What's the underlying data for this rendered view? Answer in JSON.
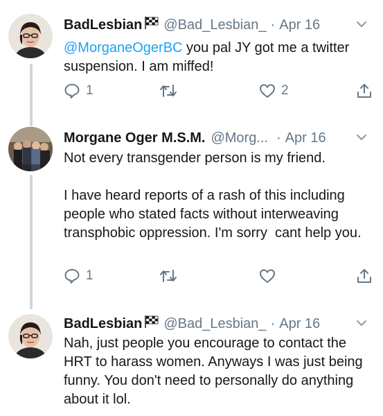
{
  "tweets": [
    {
      "display_name": "BadLesbian",
      "flag_icon": "checkered-flag-icon",
      "handle": "@Bad_Lesbian_",
      "separator": "·",
      "date": "Apr 16",
      "mention": "@MorganeOgerBC",
      "text": " you pal JY got me a twitter suspension. I am miffed!",
      "reply_count": "1",
      "retweet_count": "",
      "like_count": "2"
    },
    {
      "display_name": "Morgane Oger M.S.M.",
      "handle": "@Morg...",
      "separator": "·",
      "date": "Apr 16",
      "text": "Not every transgender person is my friend.\n\nI have heard reports of a rash of this including people who stated facts without interweaving transphobic oppression. I'm sorry  cant help you.",
      "reply_count": "1",
      "retweet_count": "",
      "like_count": ""
    },
    {
      "display_name": "BadLesbian",
      "flag_icon": "checkered-flag-icon",
      "handle": "@Bad_Lesbian_",
      "separator": "·",
      "date": "Apr 16",
      "text": "Nah, just people you encourage to contact the HRT to harass women. Anyways I was just being funny. You don't need to personally do anything about it lol."
    }
  ],
  "colors": {
    "link": "#1da1f2",
    "secondary": "#657786",
    "thread": "#ccd6dd"
  }
}
